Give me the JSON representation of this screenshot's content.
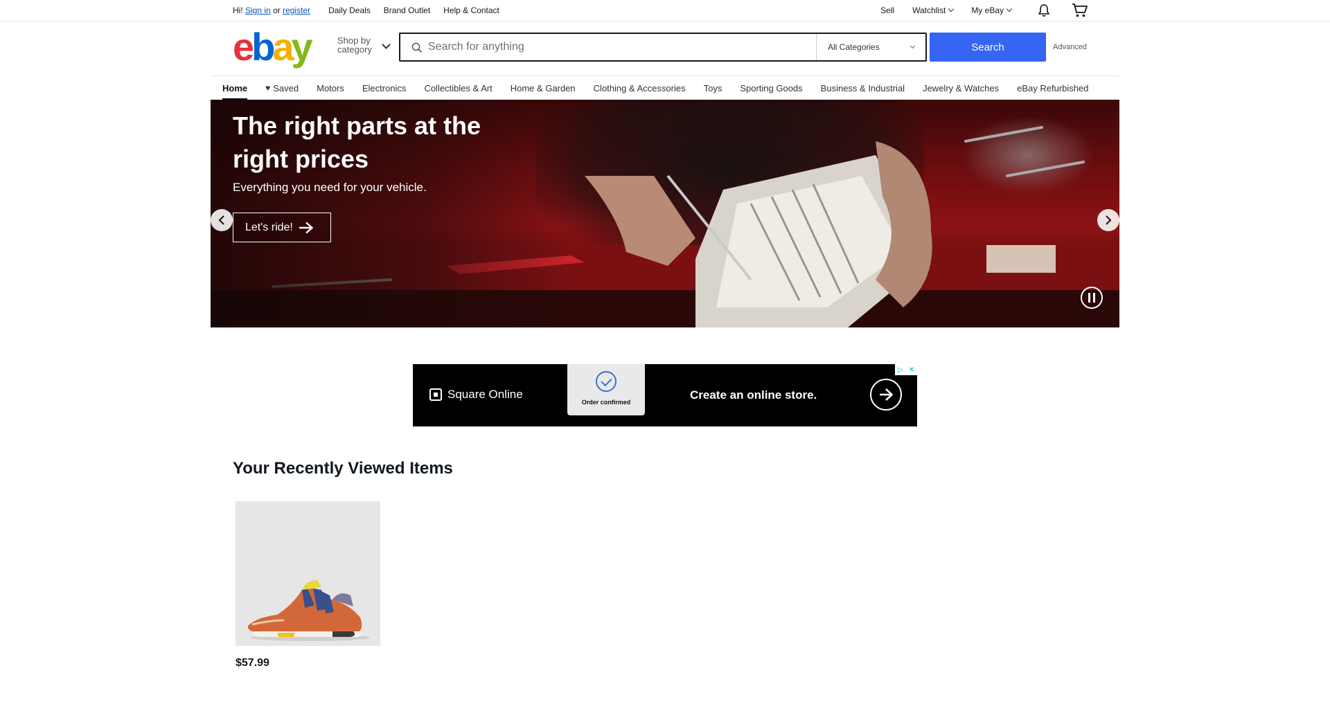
{
  "topbar": {
    "greeting": "Hi!",
    "sign_in": "Sign in",
    "or": "or",
    "register": "register",
    "daily_deals": "Daily Deals",
    "brand_outlet": "Brand Outlet",
    "help": "Help & Contact",
    "sell": "Sell",
    "watchlist": "Watchlist",
    "my_ebay": "My eBay",
    "icons": [
      "bell-icon",
      "cart-icon"
    ]
  },
  "header": {
    "logo_letters": [
      "e",
      "b",
      "a",
      "y"
    ],
    "logo_colors": [
      "#e53238",
      "#0064d2",
      "#f5af02",
      "#86b817"
    ],
    "shop_by_line1": "Shop by",
    "shop_by_line2": "category",
    "search_placeholder": "Search for anything",
    "search_value": "",
    "category_selected": "All Categories",
    "search_button": "Search",
    "advanced": "Advanced",
    "accent_color": "#3665f3"
  },
  "nav": {
    "items": [
      {
        "label": "Home",
        "active": true
      },
      {
        "label": "Saved",
        "icon": "heart-icon"
      },
      {
        "label": "Motors"
      },
      {
        "label": "Electronics"
      },
      {
        "label": "Collectibles & Art"
      },
      {
        "label": "Home & Garden"
      },
      {
        "label": "Clothing & Accessories"
      },
      {
        "label": "Toys"
      },
      {
        "label": "Sporting Goods"
      },
      {
        "label": "Business & Industrial"
      },
      {
        "label": "Jewelry & Watches"
      },
      {
        "label": "eBay Refurbished"
      }
    ]
  },
  "hero": {
    "title": "The right parts at the right prices",
    "subtitle": "Everything you need for your vehicle.",
    "cta": "Let's ride!"
  },
  "ad": {
    "brand": "Square Online",
    "card_text": "Order confirmed",
    "headline": "Create an online store."
  },
  "recently_viewed": {
    "title": "Your Recently Viewed Items",
    "items": [
      {
        "price": "$57.99",
        "image": "sneaker"
      }
    ]
  }
}
